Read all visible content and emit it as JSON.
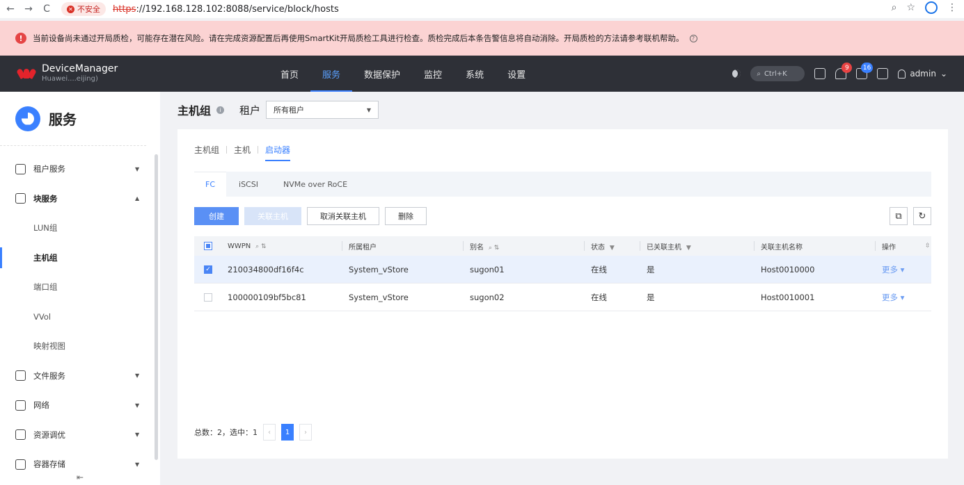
{
  "browser": {
    "back": "←",
    "forward": "→",
    "reload": "C",
    "security_label": "不安全",
    "url_scheme": "https",
    "url_rest": "://192.168.128.102:8088/service/block/hosts"
  },
  "warning": {
    "text": "当前设备尚未通过开局质检，可能存在潜在风险。请在完成资源配置后再使用SmartKit开局质检工具进行检查。质检完成后本条告警信息将自动消除。开局质检的方法请参考联机帮助。",
    "icon": "!"
  },
  "topnav": {
    "brand": "DeviceManager",
    "brand_sub": "Huawei....eijing)",
    "logo_text": "HUAWEI",
    "menu": [
      "首页",
      "服务",
      "数据保护",
      "监控",
      "系统",
      "设置"
    ],
    "active_menu": "服务",
    "search_hint": "Ctrl+K",
    "bell_badge": "9",
    "alarm_badge": "16",
    "user": "admin"
  },
  "sidebar": {
    "title": "服务",
    "items": [
      {
        "label": "租户服务",
        "arrow": "▼"
      },
      {
        "label": "块服务",
        "arrow": "▲"
      },
      {
        "label": "LUN组"
      },
      {
        "label": "主机组"
      },
      {
        "label": "端口组"
      },
      {
        "label": "VVol"
      },
      {
        "label": "映射视图"
      },
      {
        "label": "文件服务",
        "arrow": "▼"
      },
      {
        "label": "网络",
        "arrow": "▼"
      },
      {
        "label": "资源调优",
        "arrow": "▼"
      },
      {
        "label": "容器存储",
        "arrow": "▼"
      }
    ],
    "collapse": "⇤"
  },
  "main": {
    "title": "主机组",
    "tenant_label": "租户",
    "tenant_value": "所有租户",
    "subtabs": [
      "主机组",
      "主机",
      "启动器"
    ],
    "active_subtab": "启动器",
    "protocol_tabs": [
      "FC",
      "iSCSI",
      "NVMe over RoCE"
    ],
    "active_protocol": "FC",
    "buttons": {
      "create": "创建",
      "associate": "关联主机",
      "unassociate": "取消关联主机",
      "delete": "删除"
    },
    "table": {
      "headers": [
        "WWPN",
        "所属租户",
        "别名",
        "状态",
        "已关联主机",
        "关联主机名称",
        "操作"
      ],
      "rows": [
        {
          "wwpn": "210034800df16f4c",
          "tenant": "System_vStore",
          "alias": "sugon01",
          "status": "在线",
          "associated": "是",
          "host": "Host0010000",
          "op": "更多",
          "checked": true
        },
        {
          "wwpn": "100000109bf5bc81",
          "tenant": "System_vStore",
          "alias": "sugon02",
          "status": "在线",
          "associated": "是",
          "host": "Host0010001",
          "op": "更多",
          "checked": false
        }
      ]
    },
    "pager": {
      "summary": "总数：2，选中：1",
      "current": "1"
    }
  }
}
